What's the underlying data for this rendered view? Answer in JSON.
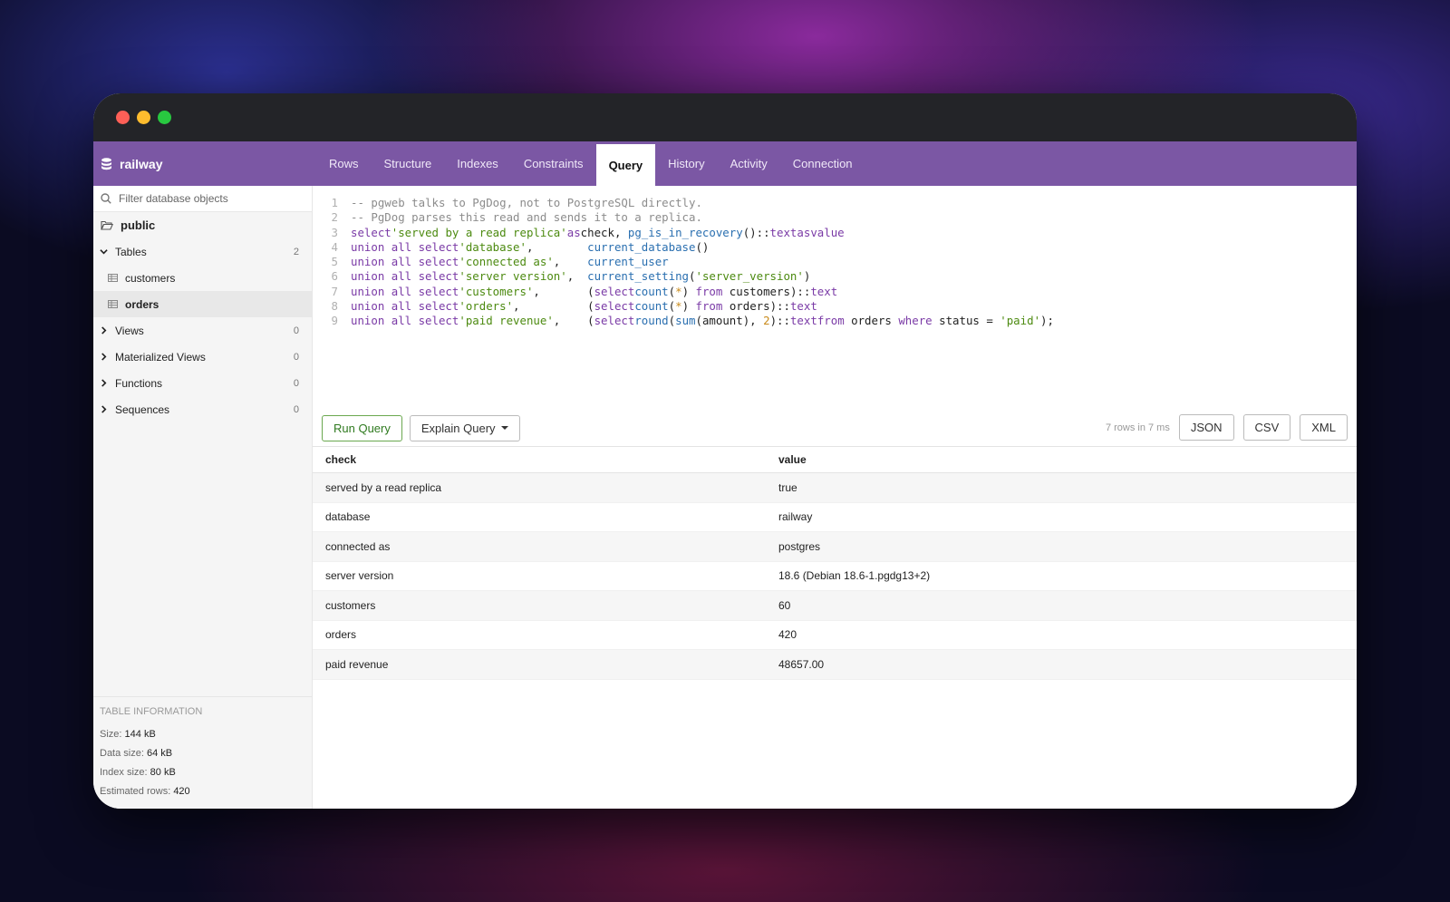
{
  "app": {
    "database_name": "railway"
  },
  "tabs": [
    {
      "label": "Rows",
      "active": false
    },
    {
      "label": "Structure",
      "active": false
    },
    {
      "label": "Indexes",
      "active": false
    },
    {
      "label": "Constraints",
      "active": false
    },
    {
      "label": "Query",
      "active": true
    },
    {
      "label": "History",
      "active": false
    },
    {
      "label": "Activity",
      "active": false
    },
    {
      "label": "Connection",
      "active": false
    }
  ],
  "sidebar": {
    "filter_placeholder": "Filter database objects",
    "schema": "public",
    "groups": [
      {
        "label": "Tables",
        "count": "2",
        "expanded": true,
        "items": [
          "customers",
          "orders"
        ],
        "selected": "orders"
      },
      {
        "label": "Views",
        "count": "0",
        "expanded": false
      },
      {
        "label": "Materialized Views",
        "count": "0",
        "expanded": false
      },
      {
        "label": "Functions",
        "count": "0",
        "expanded": false
      },
      {
        "label": "Sequences",
        "count": "0",
        "expanded": false
      }
    ],
    "table_info": {
      "title": "TABLE INFORMATION",
      "size_label": "Size:",
      "size": "144 kB",
      "data_size_label": "Data size:",
      "data_size": "64 kB",
      "index_size_label": "Index size:",
      "index_size": "80 kB",
      "est_rows_label": "Estimated rows:",
      "est_rows": "420"
    }
  },
  "editor": {
    "line_numbers": [
      "1",
      "2",
      "3",
      "4",
      "5",
      "6",
      "7",
      "8",
      "9"
    ]
  },
  "toolbar": {
    "run_label": "Run Query",
    "explain_label": "Explain Query",
    "stats": "7 rows in 7 ms",
    "json_label": "JSON",
    "csv_label": "CSV",
    "xml_label": "XML"
  },
  "results": {
    "columns": [
      "check",
      "value"
    ],
    "rows": [
      [
        "served by a read replica",
        "true"
      ],
      [
        "database",
        "railway"
      ],
      [
        "connected as",
        "postgres"
      ],
      [
        "server version",
        "18.6 (Debian 18.6-1.pgdg13+2)"
      ],
      [
        "customers",
        "60"
      ],
      [
        "orders",
        "420"
      ],
      [
        "paid revenue",
        "48657.00"
      ]
    ]
  },
  "colors": {
    "topbar": "#7b57a4",
    "titlebar": "#232428",
    "run_button": "#2f7a1f"
  }
}
